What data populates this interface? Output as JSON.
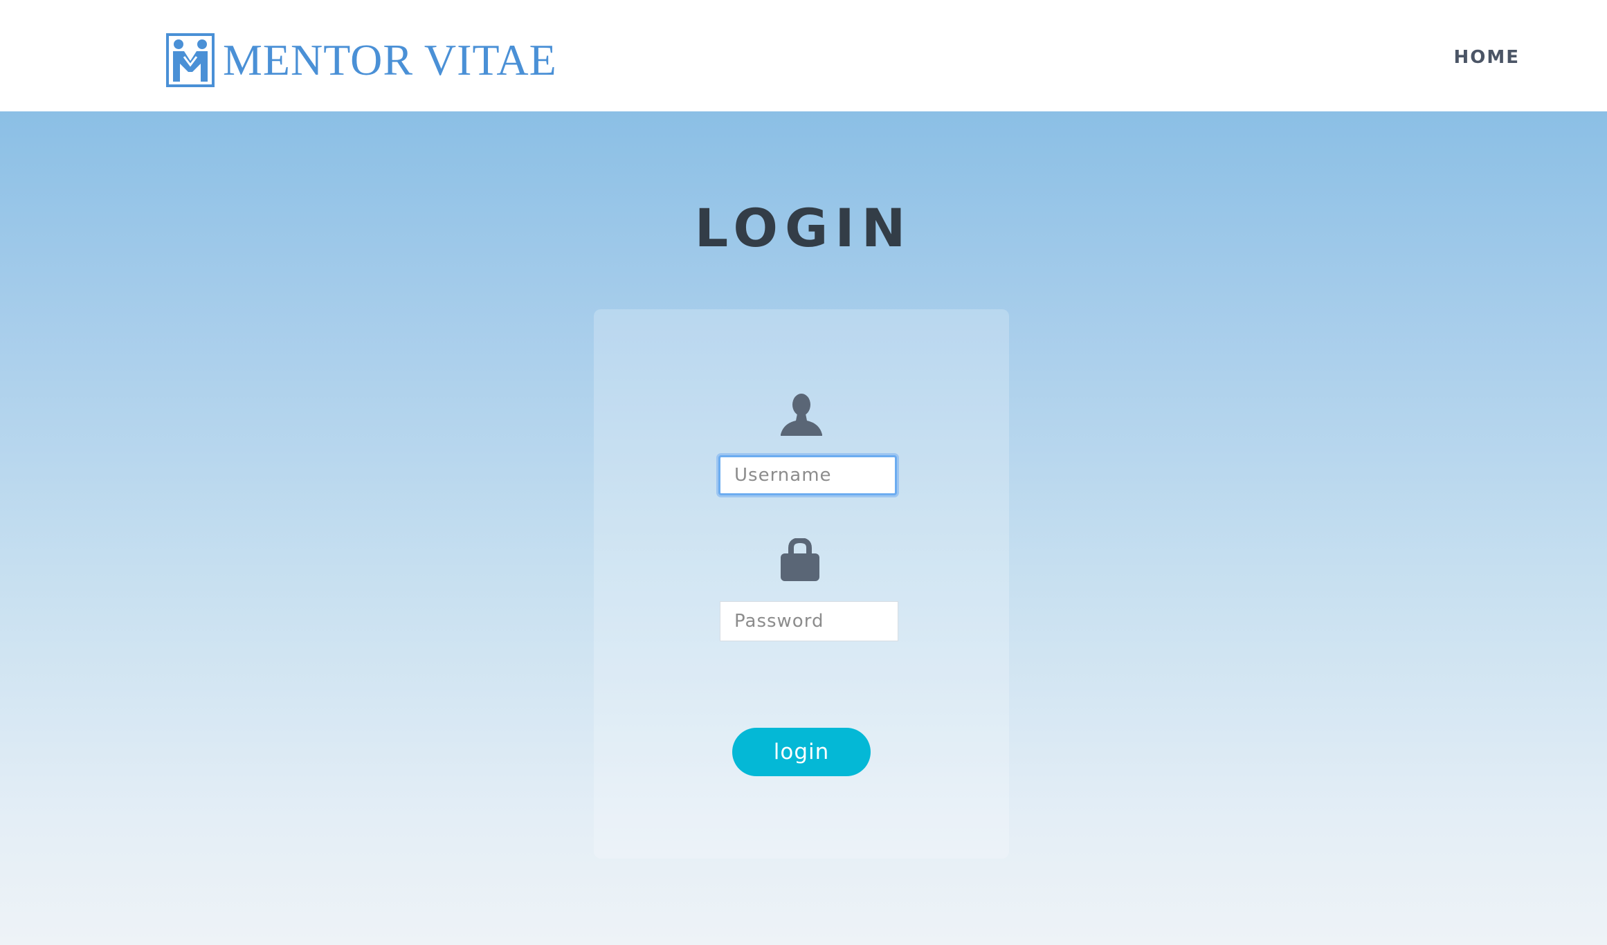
{
  "header": {
    "brand": "MENTOR VITAE",
    "logo_icon": "mentor-handshake-logo",
    "nav": {
      "home_label": "HOME"
    }
  },
  "main": {
    "title": "LOGIN",
    "form": {
      "username_icon": "user-icon",
      "username_placeholder": "Username",
      "username_value": "",
      "password_icon": "lock-icon",
      "password_placeholder": "Password",
      "password_value": "",
      "submit_label": "login"
    }
  },
  "colors": {
    "brand_blue": "#4a90d6",
    "button_cyan": "#04b8d6",
    "icon_slate": "#5a6676",
    "title_dark": "#333d47",
    "gradient_top": "#8bbfe5",
    "gradient_bottom": "#eef3f7"
  }
}
